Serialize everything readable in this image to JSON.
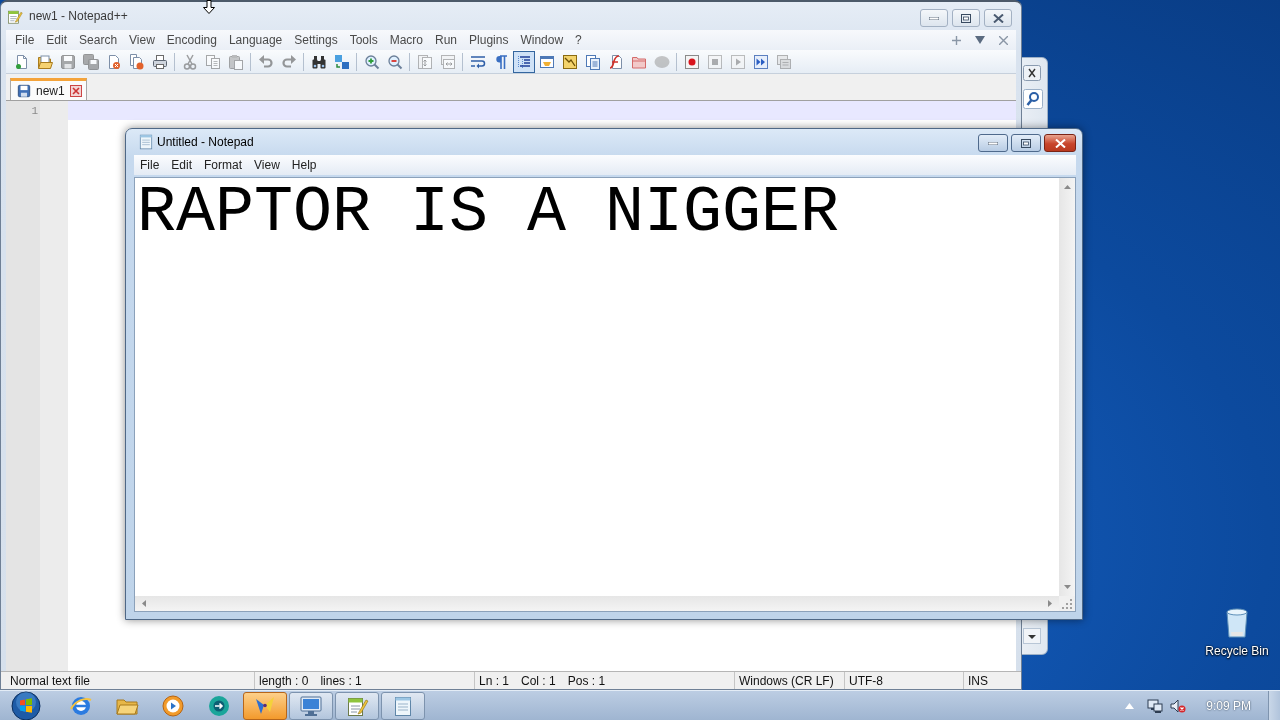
{
  "notepad_plus_plus": {
    "title": "new1 - Notepad++",
    "menu": [
      "File",
      "Edit",
      "Search",
      "View",
      "Encoding",
      "Language",
      "Settings",
      "Tools",
      "Macro",
      "Run",
      "Plugins",
      "Window",
      "?"
    ],
    "toolbar": [
      [
        {
          "kind": "new",
          "pressed": false,
          "disabled": false
        },
        {
          "kind": "open",
          "pressed": false,
          "disabled": false
        },
        {
          "kind": "save",
          "pressed": false,
          "disabled": true
        },
        {
          "kind": "saveall",
          "pressed": false,
          "disabled": true
        },
        {
          "kind": "close",
          "pressed": false,
          "disabled": false
        },
        {
          "kind": "closeall",
          "pressed": false,
          "disabled": false
        },
        {
          "kind": "print",
          "pressed": false,
          "disabled": false
        }
      ],
      [
        {
          "kind": "cut",
          "pressed": false,
          "disabled": true
        },
        {
          "kind": "copy",
          "pressed": false,
          "disabled": true
        },
        {
          "kind": "paste",
          "pressed": false,
          "disabled": true
        }
      ],
      [
        {
          "kind": "undo",
          "pressed": false,
          "disabled": true
        },
        {
          "kind": "redo",
          "pressed": false,
          "disabled": true
        }
      ],
      [
        {
          "kind": "find",
          "pressed": false,
          "disabled": false
        },
        {
          "kind": "replace",
          "pressed": false,
          "disabled": false
        }
      ],
      [
        {
          "kind": "zoomin",
          "pressed": false,
          "disabled": false
        },
        {
          "kind": "zoomout",
          "pressed": false,
          "disabled": false
        }
      ],
      [
        {
          "kind": "syncv",
          "pressed": false,
          "disabled": true
        },
        {
          "kind": "synch",
          "pressed": false,
          "disabled": true
        }
      ],
      [
        {
          "kind": "wrap",
          "pressed": false,
          "disabled": false
        },
        {
          "kind": "allchars",
          "pressed": false,
          "disabled": false
        },
        {
          "kind": "indent",
          "pressed": true,
          "disabled": false
        },
        {
          "kind": "udl",
          "pressed": false,
          "disabled": false
        },
        {
          "kind": "docmap",
          "pressed": false,
          "disabled": false
        },
        {
          "kind": "doclist",
          "pressed": false,
          "disabled": false
        },
        {
          "kind": "funclist",
          "pressed": false,
          "disabled": false
        },
        {
          "kind": "workspace",
          "pressed": false,
          "disabled": false
        },
        {
          "kind": "monitor",
          "pressed": false,
          "disabled": true
        }
      ],
      [
        {
          "kind": "record",
          "pressed": false,
          "disabled": false
        },
        {
          "kind": "stop",
          "pressed": false,
          "disabled": true
        },
        {
          "kind": "play",
          "pressed": false,
          "disabled": true
        },
        {
          "kind": "playmulti",
          "pressed": false,
          "disabled": false
        },
        {
          "kind": "savemacro",
          "pressed": false,
          "disabled": true
        }
      ]
    ],
    "tabs": [
      {
        "label": "new1",
        "selected": true
      }
    ],
    "line_numbers": [
      "1"
    ],
    "status_bar": [
      [
        "Normal text file"
      ],
      [
        "length : 0",
        "lines : 1"
      ],
      [
        "Ln : 1",
        "Col : 1",
        "Pos : 1"
      ],
      [
        "Windows (CR LF)"
      ],
      [
        "UTF-8"
      ],
      [
        "INS"
      ]
    ]
  },
  "notepad": {
    "title": "Untitled - Notepad",
    "menu": [
      "File",
      "Edit",
      "Format",
      "View",
      "Help"
    ],
    "text": "RAPTOR IS A NIGGER"
  },
  "desktop_icons": [
    {
      "label": "Recycle Bin"
    }
  ],
  "taskbar": {
    "buttons": [
      {
        "kind": "start",
        "running": false,
        "highlighted": false
      },
      {
        "kind": "browser",
        "running": false,
        "highlighted": false
      },
      {
        "kind": "folder",
        "running": false,
        "highlighted": false
      },
      {
        "kind": "player",
        "running": false,
        "highlighted": false
      },
      {
        "kind": "disc",
        "running": false,
        "highlighted": false
      },
      {
        "kind": "app",
        "running": true,
        "highlighted": true
      },
      {
        "kind": "screen",
        "running": true,
        "highlighted": false
      },
      {
        "kind": "editor",
        "running": true,
        "highlighted": false
      },
      {
        "kind": "notes",
        "running": true,
        "highlighted": false
      }
    ],
    "clock": "9:09 PM"
  }
}
